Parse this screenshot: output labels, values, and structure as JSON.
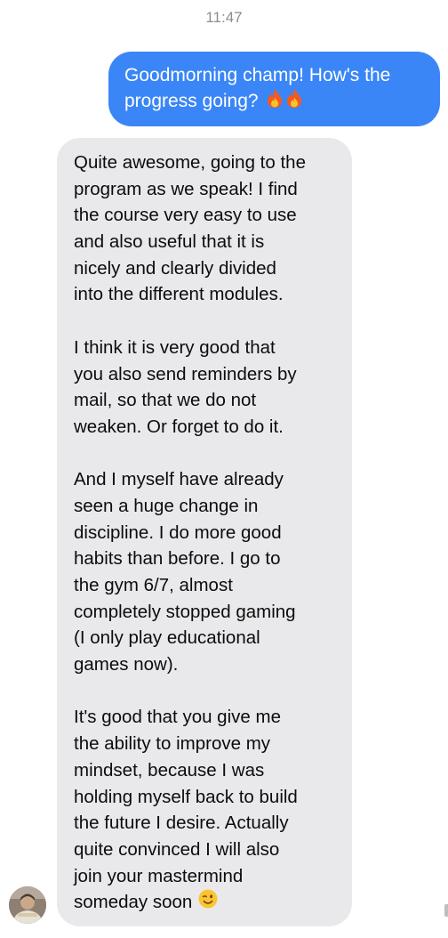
{
  "conversation": {
    "timestamp": "11:47",
    "outgoing": {
      "lines": [
        "Goodmorning champ! How's the",
        "progress going?"
      ],
      "emoji": [
        "fire-icon",
        "fire-icon"
      ],
      "color": "#3a86f7"
    },
    "incoming": {
      "color": "#e9e9eb",
      "lines": [
        "Quite awesome, going to the",
        "program as we speak! I find",
        "the course very easy to use",
        "and also useful that it is",
        "nicely and clearly divided",
        "into the different modules.",
        "",
        "I think it is very good that",
        "you also send reminders by",
        "mail, so that we do not",
        "weaken. Or forget to do it.",
        "",
        "And I myself have already",
        "seen a huge change in",
        "discipline. I do more good",
        "habits than before. I go to",
        "the gym 6/7, almost",
        "completely stopped gaming",
        "(I only play educational",
        "games now).",
        "",
        "It's good that you give me",
        "the ability to improve my",
        "mindset, because I was",
        "holding myself back to build",
        "the future I desire. Actually",
        "quite convinced I will also",
        "join your mastermind",
        "someday soon"
      ],
      "trailing_emoji": "winking-face-icon"
    },
    "sender_avatar": "avatar-photo"
  }
}
